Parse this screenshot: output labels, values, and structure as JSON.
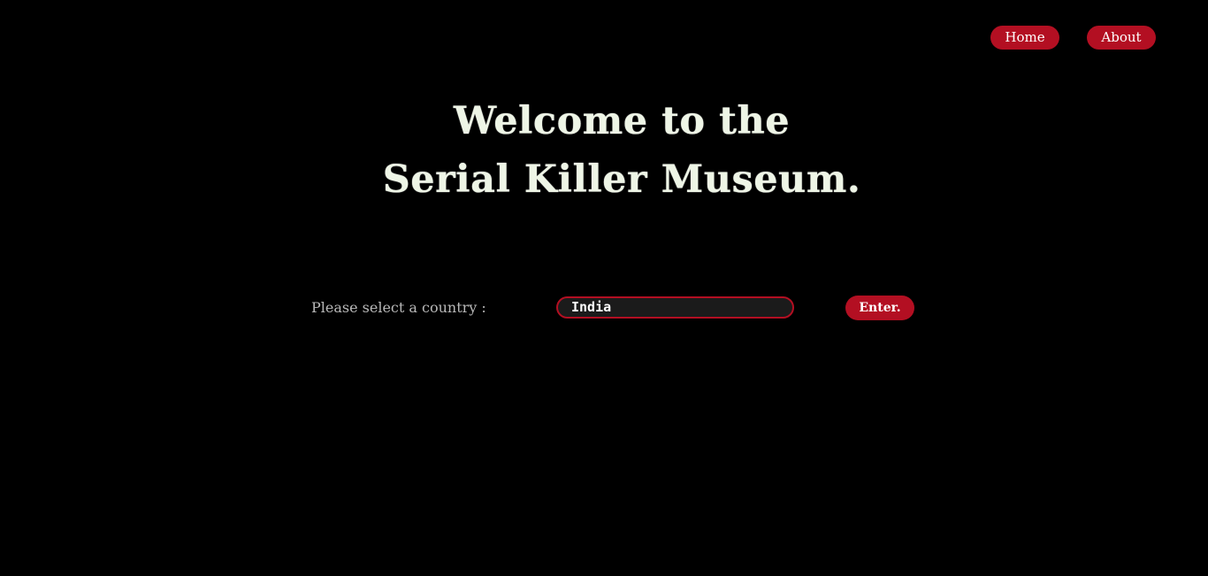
{
  "nav": {
    "home_label": "Home",
    "about_label": "About"
  },
  "hero": {
    "title_line1": "Welcome to the",
    "title_line2": "Serial Killer Museum."
  },
  "country_select": {
    "label": "Please select a country :",
    "value": "India",
    "submit_label": "Enter."
  },
  "colors": {
    "background": "#000000",
    "accent": "#b30f22",
    "title_text": "#eef5e6",
    "label_text": "#b8b8b8",
    "field_background": "#1b1b1b"
  }
}
